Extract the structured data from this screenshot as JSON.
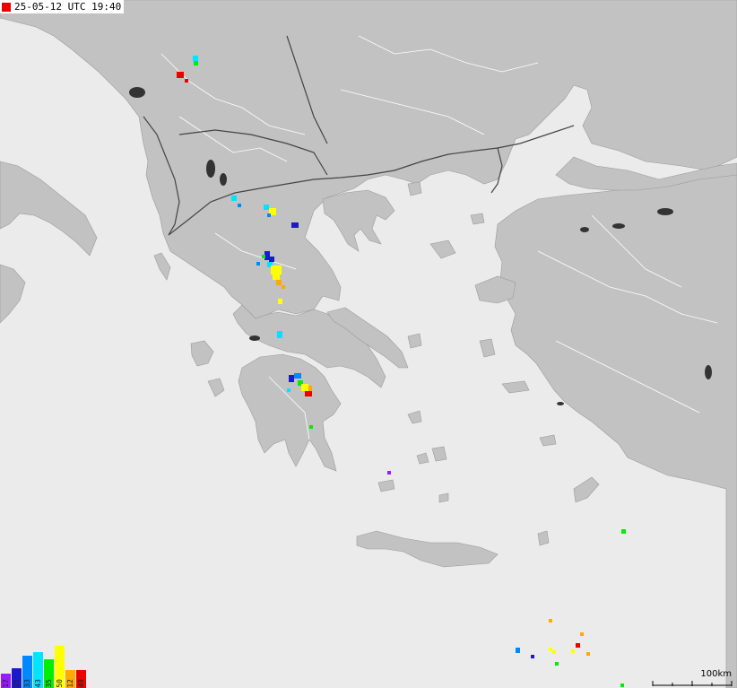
{
  "timestamp": "25-05-12 UTC 19:40",
  "timestamp_color": "#ee0000",
  "scale_label": "100km",
  "colors": {
    "sea": "#ebebeb",
    "land": "#c2c2c2",
    "lake": "#333333",
    "border": "#444444",
    "admin_line": "#ffffff"
  },
  "legend": [
    {
      "label": "17",
      "color": "#9a1aff"
    },
    {
      "label": "25",
      "color": "#1a1acc"
    },
    {
      "label": "33",
      "color": "#0088ff"
    },
    {
      "label": "43",
      "color": "#00e5ff"
    },
    {
      "label": "35",
      "color": "#00ee00"
    },
    {
      "label": "50",
      "color": "#ffff00"
    },
    {
      "label": "12",
      "color": "#ffaa00"
    },
    {
      "label": "49",
      "color": "#ee0000"
    }
  ]
}
